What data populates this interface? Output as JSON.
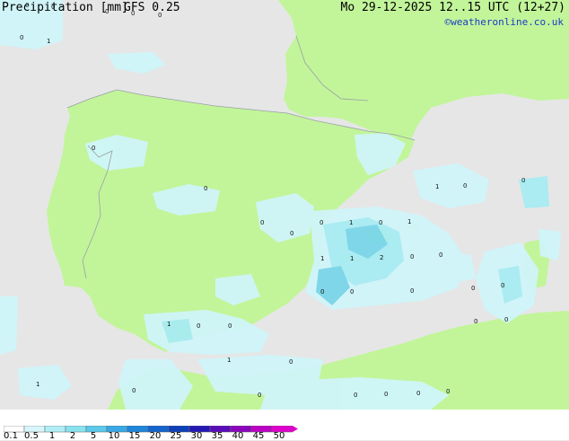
{
  "map": {
    "colors": {
      "sea": "#e6e6e6",
      "land": "#c2f59a",
      "border": "#9aa0a6",
      "rain_light": "#cff5f9",
      "rain_mid": "#a8ecf3",
      "rain_heavy": "#7ad6ea"
    },
    "point_values": [
      {
        "v": "0"
      },
      {
        "v": "0"
      },
      {
        "v": "0"
      },
      {
        "v": "0"
      },
      {
        "v": "0"
      },
      {
        "v": "0"
      },
      {
        "v": "1"
      },
      {
        "v": "0"
      },
      {
        "v": "0"
      },
      {
        "v": "0"
      },
      {
        "v": "0"
      },
      {
        "v": "1"
      },
      {
        "v": "0"
      },
      {
        "v": "1"
      },
      {
        "v": "0"
      },
      {
        "v": "0"
      },
      {
        "v": "0"
      },
      {
        "v": "1"
      },
      {
        "v": "1"
      },
      {
        "v": "2"
      },
      {
        "v": "0"
      },
      {
        "v": "0"
      },
      {
        "v": "0"
      },
      {
        "v": "0"
      },
      {
        "v": "0"
      },
      {
        "v": "0"
      },
      {
        "v": "1"
      },
      {
        "v": "0"
      },
      {
        "v": "1"
      },
      {
        "v": "0"
      },
      {
        "v": "0"
      },
      {
        "v": "0"
      },
      {
        "v": "0"
      },
      {
        "v": "1"
      },
      {
        "v": "0"
      },
      {
        "v": "1"
      },
      {
        "v": "0"
      },
      {
        "v": "0"
      },
      {
        "v": "0"
      },
      {
        "v": "0"
      },
      {
        "v": "0"
      },
      {
        "v": "0"
      }
    ]
  },
  "legend": {
    "title": "Precipitation [mm]",
    "model": "GFS 0.25",
    "ticks": [
      "0.1",
      "0.5",
      "1",
      "2",
      "5",
      "10",
      "15",
      "20",
      "25",
      "30",
      "35",
      "40",
      "45",
      "50"
    ],
    "swatch_colors": [
      "#ffffff",
      "#d8f6fa",
      "#b0eef6",
      "#88e2f0",
      "#5cc8ea",
      "#38a8e6",
      "#1e86dc",
      "#1464cc",
      "#0c40b8",
      "#2418b4",
      "#5a0cb8",
      "#8c04bc",
      "#bc02c4",
      "#e000cc"
    ]
  },
  "datetime": "Mo 29-12-2025 12..15 UTC (12+27)",
  "credit": "©weatheronline.co.uk"
}
